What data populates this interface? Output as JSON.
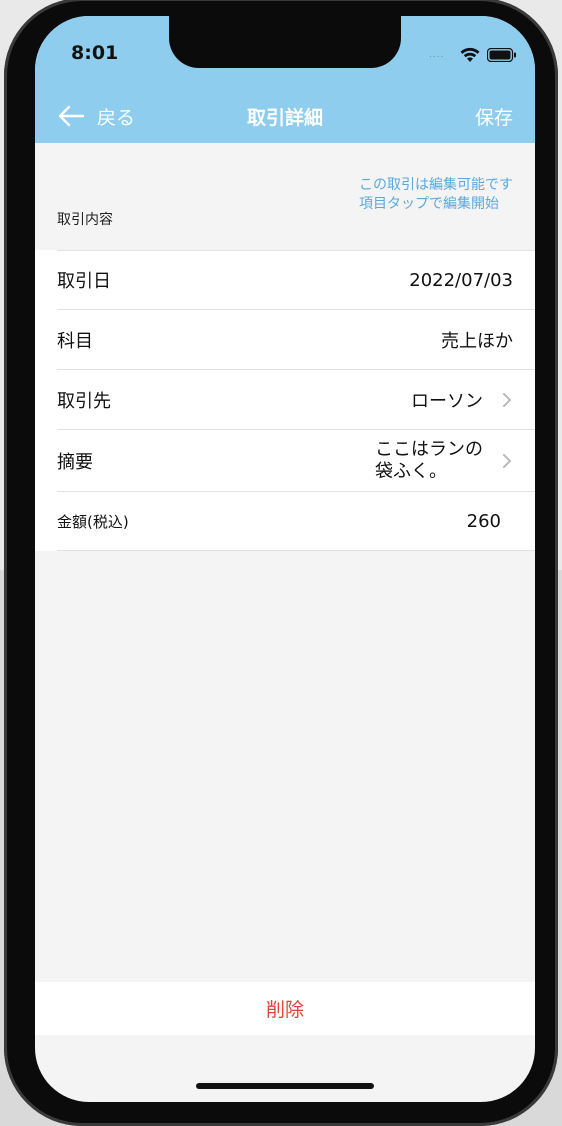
{
  "status_bar": {
    "time": "8:01",
    "signal": "....",
    "icons": [
      "wifi-icon",
      "battery-icon"
    ]
  },
  "nav": {
    "back_label": "戻る",
    "title": "取引詳細",
    "save_label": "保存"
  },
  "edit_note": {
    "line1": "この取引は編集可能です",
    "line2": "項目タップで編集開始"
  },
  "section": {
    "label": "取引内容"
  },
  "rows": {
    "date": {
      "label": "取引日",
      "value": "2022/07/03"
    },
    "category": {
      "label": "科目",
      "value": "売上ほか"
    },
    "partner": {
      "label": "取引先",
      "value": "ローソン"
    },
    "memo": {
      "label": "摘要",
      "value_line1": "ここはランの",
      "value_line2": "袋ふく。"
    },
    "amount": {
      "label": "金額(税込)",
      "value": "260"
    }
  },
  "actions": {
    "delete_label": "削除"
  },
  "colors": {
    "header": "#8fcdee",
    "accent_blue": "#5aa9de",
    "delete_red": "#e3433b"
  }
}
